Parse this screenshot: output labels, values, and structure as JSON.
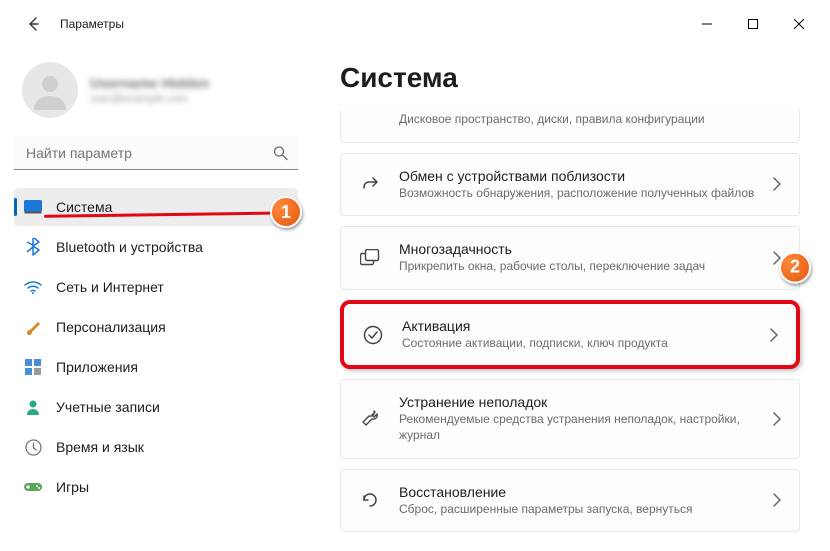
{
  "window": {
    "title": "Параметры"
  },
  "profile": {
    "name": "Username Hidden",
    "email": "user@example.com"
  },
  "search": {
    "placeholder": "Найти параметр"
  },
  "sidebar": {
    "items": [
      {
        "label": "Система"
      },
      {
        "label": "Bluetooth и устройства"
      },
      {
        "label": "Сеть и Интернет"
      },
      {
        "label": "Персонализация"
      },
      {
        "label": "Приложения"
      },
      {
        "label": "Учетные записи"
      },
      {
        "label": "Время и язык"
      },
      {
        "label": "Игры"
      }
    ]
  },
  "main": {
    "heading": "Система",
    "partial": {
      "sub": "Дисковое пространство, диски, правила конфигурации"
    },
    "cards": [
      {
        "title": "Обмен с устройствами поблизости",
        "sub": "Возможность обнаружения, расположение полученных файлов"
      },
      {
        "title": "Многозадачность",
        "sub": "Прикрепить окна, рабочие столы, переключение задач"
      },
      {
        "title": "Активация",
        "sub": "Состояние активации, подписки, ключ продукта"
      },
      {
        "title": "Устранение неполадок",
        "sub": "Рекомендуемые средства устранения неполадок, настройки, журнал"
      },
      {
        "title": "Восстановление",
        "sub": "Сброс, расширенные параметры запуска, вернуться"
      }
    ]
  },
  "markers": {
    "one": "1",
    "two": "2"
  }
}
